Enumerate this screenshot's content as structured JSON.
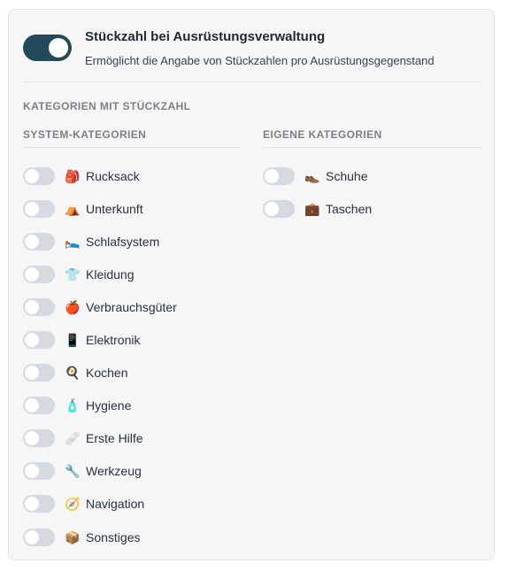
{
  "setting": {
    "title": "Stückzahl bei Ausrüstungsverwaltung",
    "description": "Ermöglicht die Angabe von Stückzahlen pro Ausrüstungsgegenstand",
    "enabled": true
  },
  "section_heading": "KATEGORIEN MIT STÜCKZAHL",
  "system": {
    "heading": "SYSTEM-KATEGORIEN",
    "items": [
      {
        "label": "Rucksack",
        "icon": "🎒",
        "icon_name": "backpack-icon",
        "enabled": false
      },
      {
        "label": "Unterkunft",
        "icon": "⛺",
        "icon_name": "tent-icon",
        "enabled": false
      },
      {
        "label": "Schlafsystem",
        "icon": "🛌",
        "icon_name": "sleeping-bed-icon",
        "enabled": false
      },
      {
        "label": "Kleidung",
        "icon": "👕",
        "icon_name": "shirt-icon",
        "enabled": false
      },
      {
        "label": "Verbrauchsgüter",
        "icon": "🍎",
        "icon_name": "apple-icon",
        "enabled": false
      },
      {
        "label": "Elektronik",
        "icon": "📱",
        "icon_name": "phone-icon",
        "enabled": false
      },
      {
        "label": "Kochen",
        "icon": "🍳",
        "icon_name": "frying-pan-icon",
        "enabled": false
      },
      {
        "label": "Hygiene",
        "icon": "🧴",
        "icon_name": "lotion-bottle-icon",
        "enabled": false
      },
      {
        "label": "Erste Hilfe",
        "icon": "🩹",
        "icon_name": "bandage-icon",
        "enabled": false
      },
      {
        "label": "Werkzeug",
        "icon": "🔧",
        "icon_name": "wrench-icon",
        "enabled": false
      },
      {
        "label": "Navigation",
        "icon": "🧭",
        "icon_name": "compass-icon",
        "enabled": false
      },
      {
        "label": "Sonstiges",
        "icon": "📦",
        "icon_name": "package-icon",
        "enabled": false
      }
    ]
  },
  "custom": {
    "heading": "EIGENE KATEGORIEN",
    "items": [
      {
        "label": "Schuhe",
        "icon": "👞",
        "icon_name": "shoe-icon",
        "enabled": false
      },
      {
        "label": "Taschen",
        "icon": "💼",
        "icon_name": "briefcase-icon",
        "enabled": false
      }
    ]
  },
  "colors": {
    "toggle_on": "#23495a",
    "toggle_off": "#d5d9e0",
    "card_background": "#f6f6f7"
  }
}
